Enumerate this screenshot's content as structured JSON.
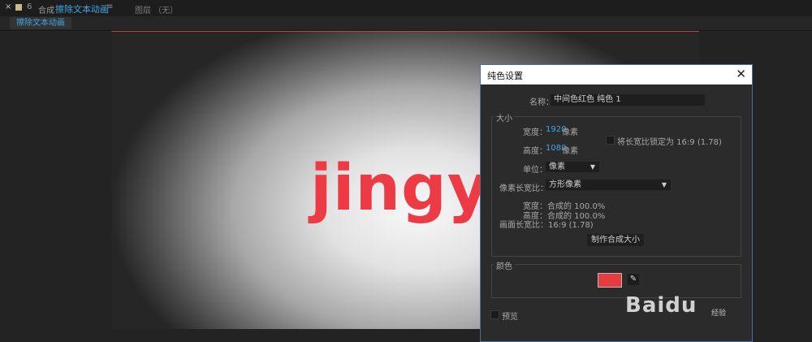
{
  "tabbar": {
    "close_glyph": "×",
    "icon2_glyph": "6",
    "comp_prefix": "合成",
    "comp_name": "擦除文本动画",
    "menu_glyph": "≡",
    "layer_label": "图层 （无）"
  },
  "subtab": {
    "label": "擦除文本动画"
  },
  "canvas": {
    "logo_text": "jingya",
    "logo_color": "#ec3b45"
  },
  "dialog": {
    "title": "纯色设置",
    "close_glyph": "✕",
    "name_label": "名称：",
    "name_value": "中间色红色 纯色 1",
    "size_group": "大小",
    "width_label": "宽度：",
    "width_value": "1920",
    "width_unit": "像素",
    "height_label": "高度：",
    "height_value": "1080",
    "height_unit": "像素",
    "lock_label": "将长宽比锁定为 16:9 (1.78)",
    "unit_label": "单位：",
    "unit_value": "像素",
    "par_label": "像素长宽比：",
    "par_value": "方形像素",
    "pct_width": "宽度：合成的 100.0%",
    "pct_height": "高度：合成的 100.0%",
    "frame_aspect": "画面长宽比：16:9 (1.78)",
    "make_comp_size": "制作合成大小",
    "color_group": "颜色",
    "swatch_color": "#e63b3f",
    "dropper_glyph": "✎",
    "preview_label": "预览"
  },
  "watermark": {
    "text": "Baidu",
    "sub": "经验"
  }
}
